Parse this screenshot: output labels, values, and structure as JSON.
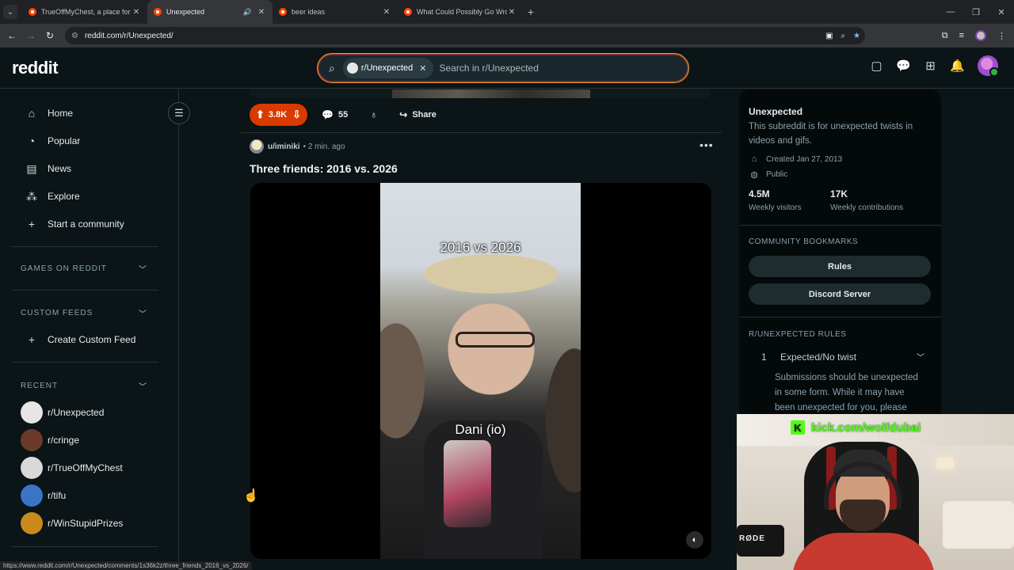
{
  "browser": {
    "tabs": [
      {
        "title": "TrueOffMyChest, a place for pe",
        "active": false,
        "audio": false
      },
      {
        "title": "Unexpected",
        "active": true,
        "audio": true
      },
      {
        "title": "beer ideas",
        "active": false,
        "audio": false
      },
      {
        "title": "What Could Possibly Go Wrong",
        "active": false,
        "audio": false
      }
    ],
    "new_tab_icon": "+",
    "url": "reddit.com/r/Unexpected/",
    "status_url": "https://www.reddit.com/r/Unexpected/comments/1s36k2z/three_friends_2016_vs_2026/"
  },
  "header": {
    "logo": "reddit",
    "search_chip": "r/Unexpected",
    "search_placeholder": "Search in r/Unexpected"
  },
  "left_sidebar": {
    "nav": [
      {
        "label": "Home",
        "icon": "home-icon"
      },
      {
        "label": "Popular",
        "icon": "popular-icon"
      },
      {
        "label": "News",
        "icon": "news-icon"
      },
      {
        "label": "Explore",
        "icon": "explore-icon"
      },
      {
        "label": "Start a community",
        "icon": "plus-icon"
      }
    ],
    "games_header": "GAMES ON REDDIT",
    "custom_feeds_header": "CUSTOM FEEDS",
    "create_custom_feed": "Create Custom Feed",
    "recent_header": "RECENT",
    "recent": [
      {
        "label": "r/Unexpected",
        "color": "#e6e6e6"
      },
      {
        "label": "r/cringe",
        "color": "#6b3a2a"
      },
      {
        "label": "r/TrueOffMyChest",
        "color": "#d9d9d9"
      },
      {
        "label": "r/tifu",
        "color": "#3a74c4"
      },
      {
        "label": "r/WinStupidPrizes",
        "color": "#c98a1b"
      }
    ]
  },
  "feed": {
    "prev_post": {
      "votes": "3.8K",
      "comments": "55",
      "share": "Share"
    },
    "post": {
      "author": "u/iminiki",
      "time": "2 min. ago",
      "title": "Three friends: 2016 vs. 2026",
      "video_caption_top": "2016 vs 2026",
      "video_caption_mid": "Dani (io)"
    }
  },
  "right_sidebar": {
    "name": "Unexpected",
    "description": "This subreddit is for unexpected twists in videos and gifs.",
    "created": "Created Jan 27, 2013",
    "visibility": "Public",
    "stats": [
      {
        "value": "4.5M",
        "label": "Weekly visitors"
      },
      {
        "value": "17K",
        "label": "Weekly contributions"
      }
    ],
    "bookmarks_header": "COMMUNITY BOOKMARKS",
    "bookmarks": [
      "Rules",
      "Discord Server"
    ],
    "rules_header": "R/UNEXPECTED RULES",
    "rule": {
      "number": "1",
      "title": "Expected/No twist",
      "text": "Submissions should be unexpected in some form. While it may have been unexpected for you, please"
    }
  },
  "webcam": {
    "kick_url": "kick.com/wolfdubai",
    "mic_brand": "RØDE"
  },
  "colors": {
    "accent_vote": "#d93a00",
    "kick_green": "#53fc18",
    "background": "#0b1416"
  }
}
